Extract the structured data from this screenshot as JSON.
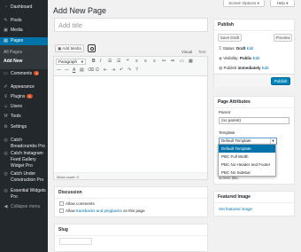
{
  "sidebar": {
    "items": [
      {
        "label": "Dashboard",
        "icon": "dashboard-icon"
      },
      {
        "label": "Posts",
        "icon": "pin-icon"
      },
      {
        "label": "Media",
        "icon": "media-icon"
      },
      {
        "label": "Pages",
        "icon": "pages-icon"
      },
      {
        "label": "Comments",
        "icon": "comment-icon",
        "badge": "3"
      },
      {
        "label": "Appearance",
        "icon": "brush-icon"
      },
      {
        "label": "Plugins",
        "icon": "plugin-icon",
        "badge": "5"
      },
      {
        "label": "Users",
        "icon": "users-icon"
      },
      {
        "label": "Tools",
        "icon": "wrench-icon"
      },
      {
        "label": "Settings",
        "icon": "settings-icon"
      },
      {
        "label": "Catch Breadcrumbs Pro",
        "icon": "breadcrumb-icon"
      },
      {
        "label": "Catch Instagram Feed Gallery Widget Pro",
        "icon": "instagram-icon"
      },
      {
        "label": "Catch Under Construction Pro",
        "icon": "construction-icon"
      },
      {
        "label": "Essential Widgets Pro",
        "icon": "widgets-icon"
      },
      {
        "label": "Collapse menu",
        "icon": "collapse-icon"
      }
    ],
    "pages_sub": [
      "All Pages",
      "Add New"
    ]
  },
  "topbar": {
    "screen_options": "Screen Options",
    "help": "Help"
  },
  "page": {
    "title": "Add New Page",
    "title_placeholder": "Add title"
  },
  "editor": {
    "add_media": "Add Media",
    "tab_visual": "Visual",
    "tab_text": "Text",
    "format_select": "Paragraph",
    "word_count": "Word count: 0"
  },
  "discussion": {
    "title": "Discussion",
    "allow_comments": "Allow comments",
    "allow_prefix": "Allow ",
    "trackbacks_link": "trackbacks and pingbacks",
    "allow_suffix": " on this page"
  },
  "slug": {
    "title": "Slug"
  },
  "publish": {
    "title": "Publish",
    "save_draft": "Save Draft",
    "preview": "Preview",
    "status_label": "Status: ",
    "status_value": "Draft",
    "visibility_label": "Visibility: ",
    "visibility_value": "Public",
    "publish_label": "Publish ",
    "publish_value": "immediately",
    "edit": "Edit",
    "publish_button": "Publish"
  },
  "page_attributes": {
    "title": "Page Attributes",
    "parent_label": "Parent",
    "parent_value": "(no parent)",
    "template_label": "Template",
    "template_value": "Default Template",
    "options": [
      "Default Template",
      "PBC Full Width",
      "PBC No Header and Footer",
      "PBC No Sidebar"
    ],
    "help_tail": "screen title."
  },
  "featured_image": {
    "title": "Featured Image",
    "set_link": "Set featured image"
  }
}
